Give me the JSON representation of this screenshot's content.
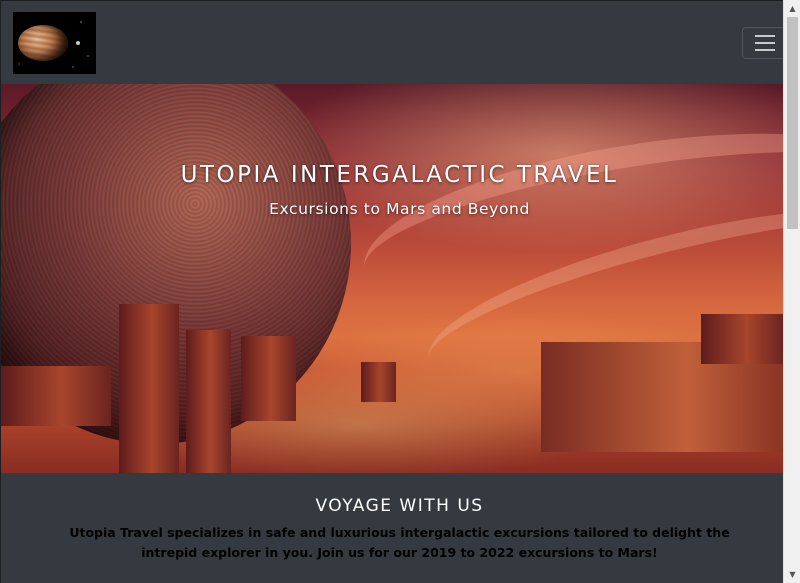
{
  "navbar": {
    "logo_alt": "planet logo",
    "toggler_icon": "hamburger-menu-icon"
  },
  "hero": {
    "title": "UTOPIA INTERGALACTIC TRAVEL",
    "subtitle": "Excursions to Mars and Beyond"
  },
  "section": {
    "title": "VOYAGE WITH US",
    "body": "Utopia Travel specializes in safe and luxurious intergalactic excursions tailored to delight the intrepid explorer in you. Join us for our 2019 to 2022 excursions to Mars!"
  },
  "scrollbar": {
    "up_icon": "scroll-up-arrow-icon",
    "down_icon": "scroll-down-arrow-icon"
  },
  "colors": {
    "navbar_bg": "#343a40",
    "section_bg": "#343a40",
    "section_text": "#000000",
    "hero_text": "#ffffff"
  }
}
